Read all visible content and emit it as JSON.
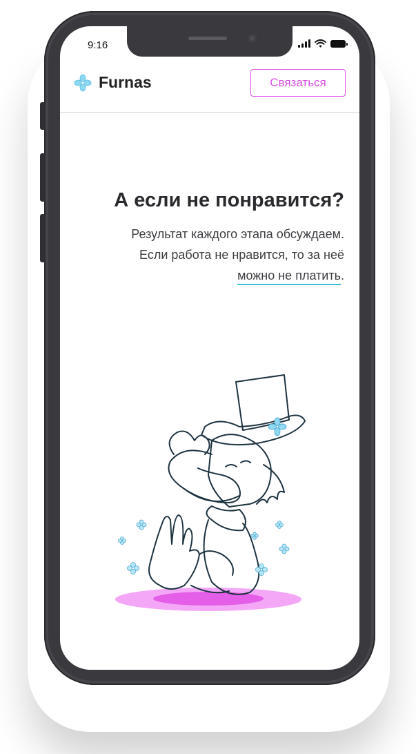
{
  "status_bar": {
    "time": "9:16"
  },
  "header": {
    "brand": "Furnas",
    "contact_label": "Связаться"
  },
  "main": {
    "headline": "А если не понравится?",
    "paragraph_line1": "Результат каждого этапа обсуждаем.",
    "paragraph_line2": "Если работа не нравится, то за неё",
    "link_text": "можно не платить",
    "link_suffix": "."
  },
  "colors": {
    "accent": "#e254e6",
    "link_underline": "#3fb8d8",
    "flower": "#8fd8f2"
  }
}
